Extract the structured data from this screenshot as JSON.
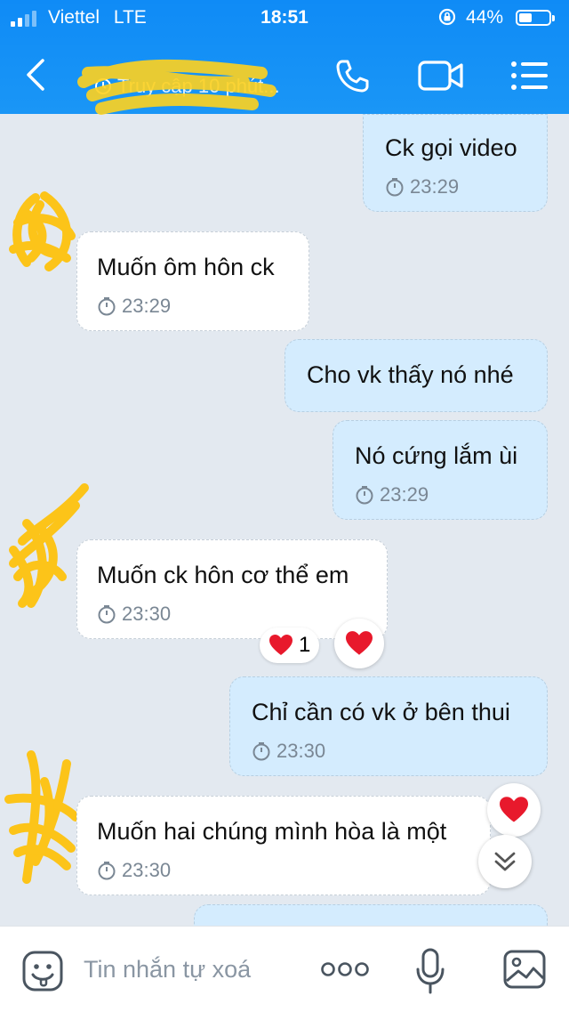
{
  "status_bar": {
    "carrier": "Viettel",
    "network": "LTE",
    "time": "18:51",
    "battery": "44%",
    "battery_level": 0.44,
    "icons": [
      "signal-icon",
      "rotation-lock-icon",
      "battery-icon"
    ]
  },
  "header": {
    "contact_name": "",
    "last_seen": "Truy cập 10 phút...",
    "icons": [
      "back-icon",
      "phone-icon",
      "video-call-icon",
      "menu-icon"
    ]
  },
  "messages": [
    {
      "direction": "out",
      "text": "Ck gọi video",
      "time": "23:29"
    },
    {
      "direction": "in",
      "text": "Muốn ôm hôn ck",
      "time": "23:29"
    },
    {
      "direction": "out",
      "text": "Cho vk thấy nó nhé",
      "time": ""
    },
    {
      "direction": "out",
      "text": "Nó cứng lắm ùi",
      "time": "23:29"
    },
    {
      "direction": "in",
      "text": "Muốn ck hôn cơ thể em",
      "time": "23:30",
      "reaction": {
        "emoji": "heart",
        "count": "1"
      }
    },
    {
      "direction": "out",
      "text": "Chỉ cần có vk ở bên thui",
      "time": "23:30"
    },
    {
      "direction": "in",
      "text": "Muốn hai chúng mình hòa là một",
      "time": "23:30"
    }
  ],
  "composer": {
    "placeholder": "Tin nhắn tự xoá",
    "icons": [
      "sticker-icon",
      "more-icon",
      "microphone-icon",
      "image-icon"
    ]
  },
  "colors": {
    "header": "#1a96f6",
    "background": "#e3e9f0",
    "outgoing_bubble": "#d4ecfe",
    "incoming_bubble": "#ffffff",
    "heart": "#e8192c",
    "censor_scribble": "#ffc107"
  }
}
